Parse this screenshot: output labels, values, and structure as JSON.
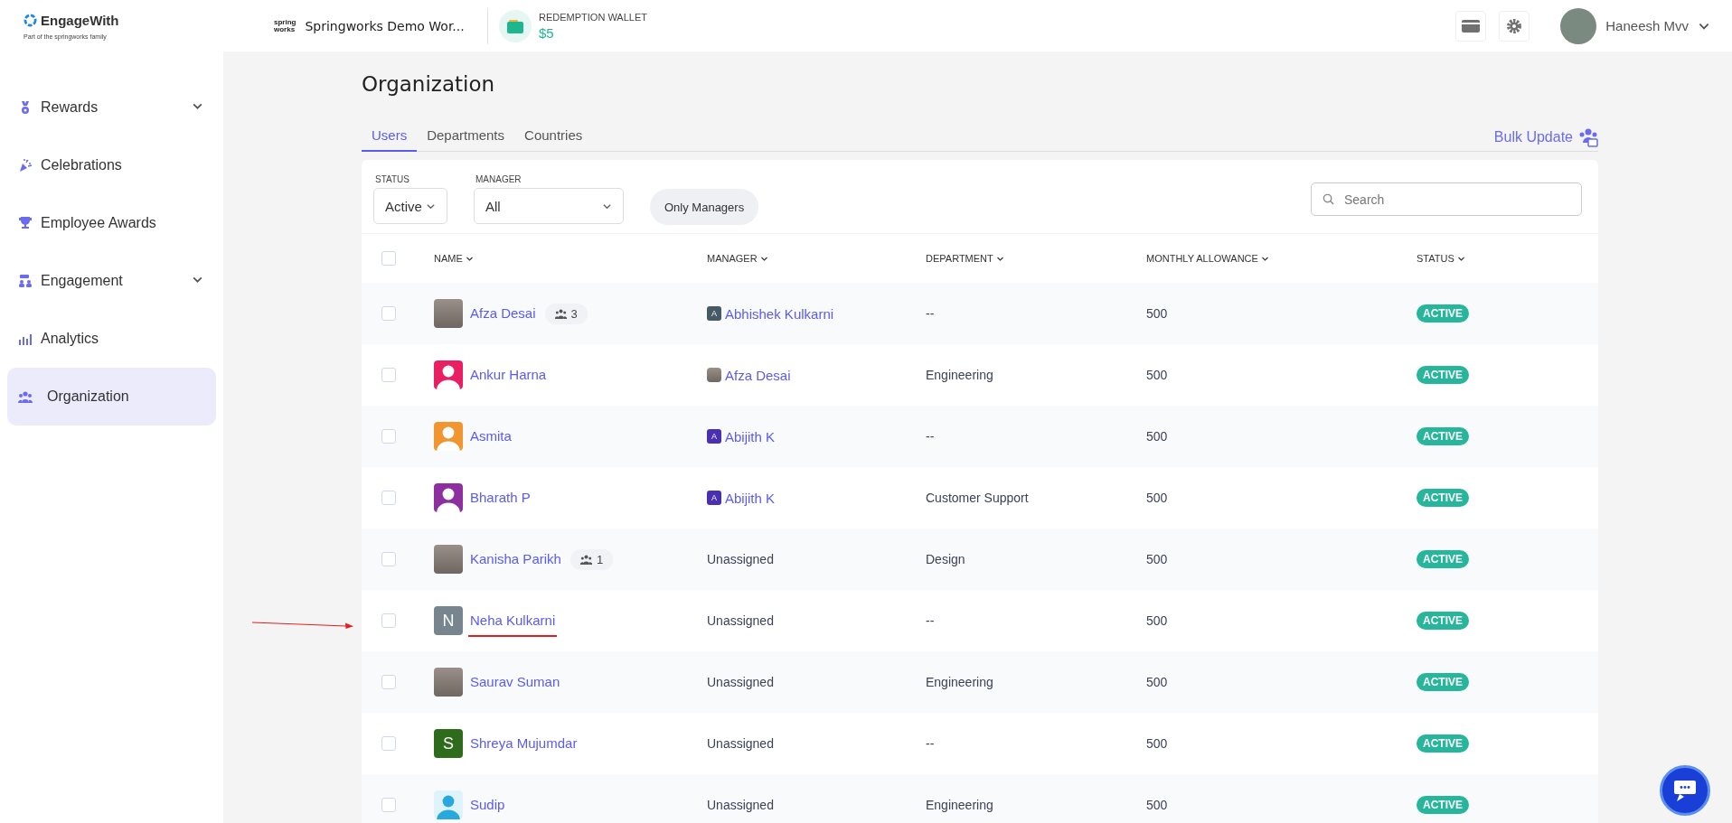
{
  "brand": {
    "name": "EngageWith",
    "tagline": "Part of the springworks family"
  },
  "workspace": {
    "logo_lines": [
      "spring",
      "works"
    ],
    "name": "Springworks Demo Wor..."
  },
  "wallet": {
    "label": "REDEMPTION WALLET",
    "amount": "$5"
  },
  "user": {
    "name": "Haneesh Mvv"
  },
  "sidebar": {
    "items": [
      {
        "label": "Rewards",
        "expandable": true,
        "selected": false
      },
      {
        "label": "Celebrations",
        "expandable": false,
        "selected": false
      },
      {
        "label": "Employee Awards",
        "expandable": false,
        "selected": false
      },
      {
        "label": "Engagement",
        "expandable": true,
        "selected": false
      },
      {
        "label": "Analytics",
        "expandable": false,
        "selected": false
      },
      {
        "label": "Organization",
        "expandable": false,
        "selected": true
      }
    ]
  },
  "page": {
    "title": "Organization"
  },
  "tabs": [
    {
      "label": "Users",
      "selected": true
    },
    {
      "label": "Departments",
      "selected": false
    },
    {
      "label": "Countries",
      "selected": false
    }
  ],
  "bulk_update": {
    "label": "Bulk Update"
  },
  "filters": {
    "status": {
      "label": "STATUS",
      "value": "Active"
    },
    "manager": {
      "label": "MANAGER",
      "value": "All"
    },
    "only_managers": {
      "label": "Only Managers"
    }
  },
  "search": {
    "placeholder": "Search"
  },
  "table": {
    "select_all_checked": false,
    "columns": [
      "NAME",
      "MANAGER",
      "DEPARTMENT",
      "MONTHLY ALLOWANCE",
      "STATUS"
    ],
    "rows": [
      {
        "checked": false,
        "highlighted": false,
        "name": "Afza Desai",
        "avatar": {
          "kind": "photo"
        },
        "team_count": "3",
        "manager": {
          "name": "Abhishek Kulkarni",
          "assigned": true,
          "avatar": {
            "kind": "initial",
            "letter": "A",
            "color": "#455a64"
          }
        },
        "department": "--",
        "allowance": "500",
        "status": "ACTIVE"
      },
      {
        "checked": false,
        "highlighted": false,
        "name": "Ankur Harna",
        "avatar": {
          "kind": "silhouette",
          "color": "#e91e63"
        },
        "manager": {
          "name": "Afza Desai",
          "assigned": true,
          "avatar": {
            "kind": "photo"
          }
        },
        "department": "Engineering",
        "allowance": "500",
        "status": "ACTIVE"
      },
      {
        "checked": false,
        "highlighted": false,
        "name": "Asmita",
        "avatar": {
          "kind": "silhouette",
          "color": "#f0952f"
        },
        "manager": {
          "name": "Abijith K",
          "assigned": true,
          "avatar": {
            "kind": "initial",
            "letter": "A",
            "color": "#4a2fb0"
          }
        },
        "department": "--",
        "allowance": "500",
        "status": "ACTIVE"
      },
      {
        "checked": false,
        "highlighted": false,
        "name": "Bharath P",
        "avatar": {
          "kind": "silhouette",
          "color": "#8e2fa0"
        },
        "manager": {
          "name": "Abijith K",
          "assigned": true,
          "avatar": {
            "kind": "initial",
            "letter": "A",
            "color": "#4a2fb0"
          }
        },
        "department": "Customer Support",
        "allowance": "500",
        "status": "ACTIVE"
      },
      {
        "checked": false,
        "highlighted": false,
        "name": "Kanisha Parikh",
        "avatar": {
          "kind": "photo"
        },
        "team_count": "1",
        "manager": {
          "name": "Unassigned",
          "assigned": false
        },
        "department": "Design",
        "allowance": "500",
        "status": "ACTIVE"
      },
      {
        "checked": false,
        "highlighted": true,
        "name": "Neha Kulkarni",
        "avatar": {
          "kind": "initial",
          "letter": "N",
          "color": "#78858f"
        },
        "manager": {
          "name": "Unassigned",
          "assigned": false
        },
        "department": "--",
        "allowance": "500",
        "status": "ACTIVE"
      },
      {
        "checked": false,
        "highlighted": false,
        "name": "Saurav Suman",
        "avatar": {
          "kind": "photo"
        },
        "manager": {
          "name": "Unassigned",
          "assigned": false
        },
        "department": "Engineering",
        "allowance": "500",
        "status": "ACTIVE"
      },
      {
        "checked": false,
        "highlighted": false,
        "name": "Shreya Mujumdar",
        "avatar": {
          "kind": "initial",
          "letter": "S",
          "color": "#2e6b1c"
        },
        "manager": {
          "name": "Unassigned",
          "assigned": false
        },
        "department": "--",
        "allowance": "500",
        "status": "ACTIVE"
      },
      {
        "checked": false,
        "highlighted": false,
        "name": "Sudip",
        "avatar": {
          "kind": "silhouette_light",
          "color": "#29a8dd"
        },
        "manager": {
          "name": "Unassigned",
          "assigned": false
        },
        "department": "Engineering",
        "allowance": "500",
        "status": "ACTIVE"
      }
    ]
  }
}
